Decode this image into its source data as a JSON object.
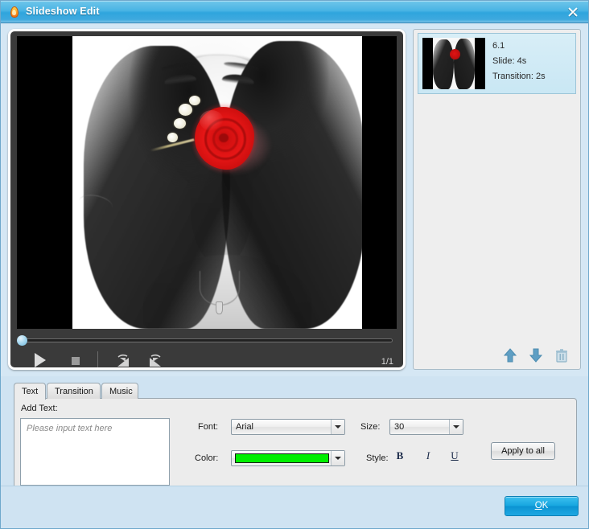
{
  "window": {
    "title": "Slideshow Edit",
    "app_icon": "flame-icon",
    "close_icon": "close-icon",
    "accent_color": "#2fa5dd",
    "body_color": "#cfe3f2"
  },
  "preview": {
    "image_alt": "black-and-white portrait of a woman holding a red rose",
    "page_counter": "1/1",
    "seek_position_percent": 0,
    "controls": [
      {
        "name": "play-button",
        "icon": "play-icon"
      },
      {
        "name": "stop-button",
        "icon": "stop-icon"
      },
      {
        "name": "rotate-left-button",
        "icon": "rotate-left-icon"
      },
      {
        "name": "rotate-right-button",
        "icon": "rotate-right-icon"
      }
    ]
  },
  "thumbnails": {
    "items": [
      {
        "name": "6.1",
        "slide": "Slide: 4s",
        "transition": "Transition: 2s",
        "selected": true
      }
    ],
    "toolbar": [
      {
        "name": "move-up-button",
        "icon": "arrow-up-icon"
      },
      {
        "name": "move-down-button",
        "icon": "arrow-down-icon"
      },
      {
        "name": "delete-button",
        "icon": "trash-icon"
      }
    ]
  },
  "tabs": [
    {
      "id": "text",
      "label": "Text",
      "active": true
    },
    {
      "id": "transition",
      "label": "Transition",
      "active": false
    },
    {
      "id": "music",
      "label": "Music",
      "active": false
    }
  ],
  "text_tab": {
    "add_text_label": "Add Text:",
    "text_input_value": "",
    "text_input_placeholder": "Please input text here",
    "font_label": "Font:",
    "font_value": "Arial",
    "size_label": "Size:",
    "size_value": "30",
    "color_label": "Color:",
    "color_value": "#00ef00",
    "style_label": "Style:",
    "bold_label": "B",
    "italic_label": "I",
    "underline_label": "U",
    "apply_to_all_label": "Apply to all"
  },
  "footer": {
    "ok_label": "OK",
    "ok_accesskey_letter": "O"
  }
}
